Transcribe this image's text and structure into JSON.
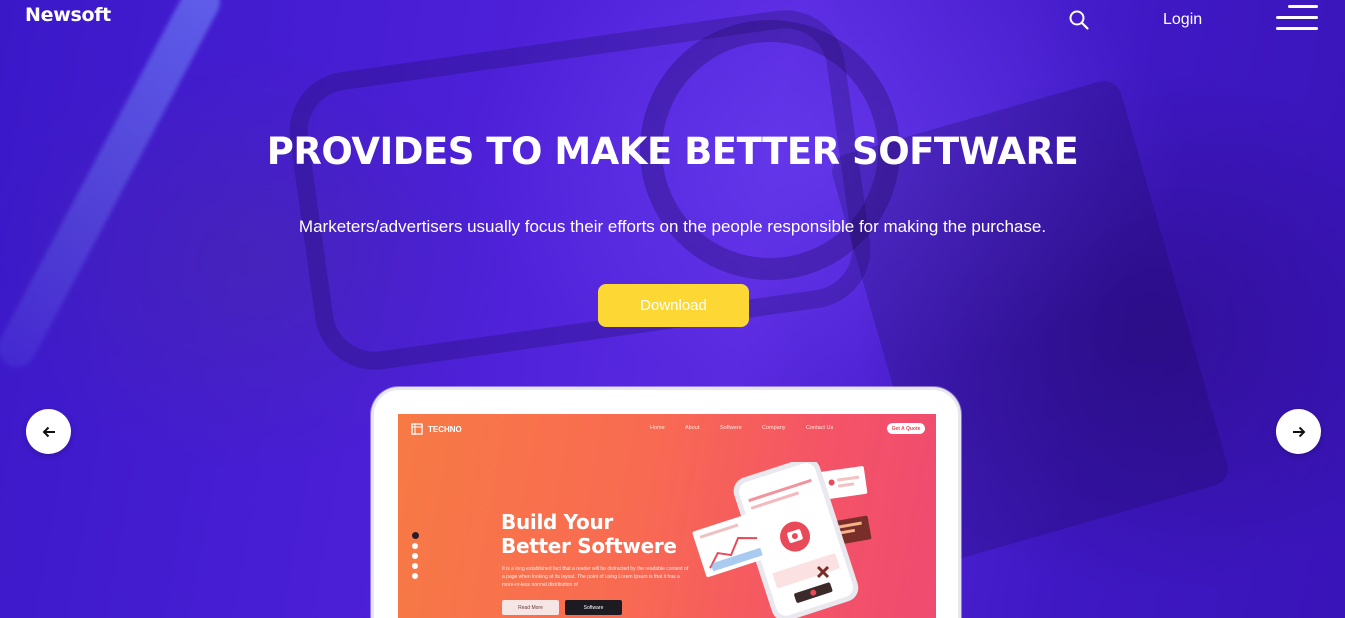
{
  "header": {
    "brand": "Newsoft",
    "search_icon": "search-icon",
    "login_label": "Login",
    "menu_icon": "hamburger-menu-icon"
  },
  "hero": {
    "headline": "PROVIDES TO MAKE BETTER SOFTWARE",
    "subline": "Marketers/advertisers usually focus their efforts on the people responsible for making the purchase.",
    "download_label": "Download",
    "prev_icon": "arrow-left-icon",
    "next_icon": "arrow-right-icon"
  },
  "mockup": {
    "logo_text": "TECHNO",
    "nav": [
      "Home",
      "About",
      "Softwere",
      "Company",
      "Contact Us"
    ],
    "quote_label": "Get A Quote",
    "title_line1": "Build Your",
    "title_line2": "Better Softwere",
    "body": "It is a long established fact that a reader will be distracted by the readable content of a page when looking at its layout. The point of using Lorem Ipsum is that it has a more-or-less normal distribution of",
    "read_more_label": "Read More",
    "software_label": "Software"
  },
  "colors": {
    "background": "#4a1cd6",
    "accent_button": "#fdd835",
    "mockup_gradient_start": "#f77a45",
    "mockup_gradient_end": "#ef4a72"
  }
}
